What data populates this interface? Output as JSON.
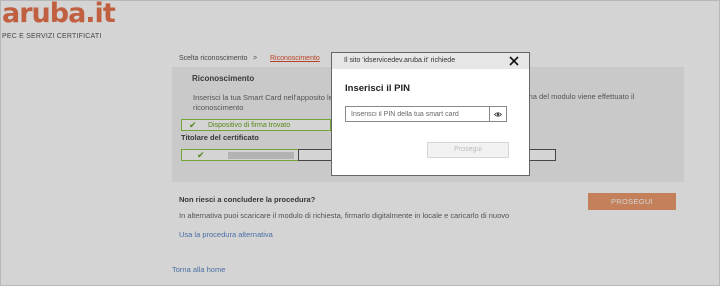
{
  "header": {
    "logo": "aruba.it",
    "tagline": "PEC E SERVIZI CERTIFICATI"
  },
  "breadcrumb": {
    "step1": "Scelta riconoscimento",
    "separator": ">",
    "step2": "Riconoscimento"
  },
  "recognition": {
    "title": "Riconoscimento",
    "text_line1": "Inserisci la tua Smart Card nell'apposito lett",
    "text_line2": "riconoscimento",
    "text_right": "rma del modulo viene effettuato il",
    "device_status": "Dispositivo di firma trovato",
    "holder_title": "Titolare del certificato"
  },
  "help": {
    "title": "Non riesci a concludere la procedura?",
    "text": "In alternativa puoi scaricare il modulo di richiesta, firmarlo digitalmente in locale e caricarlo di nuovo",
    "alt_link": "Usa la procedura alternativa"
  },
  "proceed_button": "PROSEGUI",
  "home_link": "Torna alla home",
  "dialog": {
    "header": "Il sito 'idservicedev.aruba.it' richiede",
    "title": "Inserisci il PIN",
    "pin_placeholder": "Inserisci il PIN della tua smart card",
    "submit_button": "Prosegui"
  },
  "icons": {
    "close": "close-icon",
    "eye": "eye-icon",
    "check": "check-icon"
  },
  "colors": {
    "brand": "#e8744f",
    "link": "#5a86c5",
    "success": "#8cc63f",
    "button": "#eb9a6e"
  }
}
